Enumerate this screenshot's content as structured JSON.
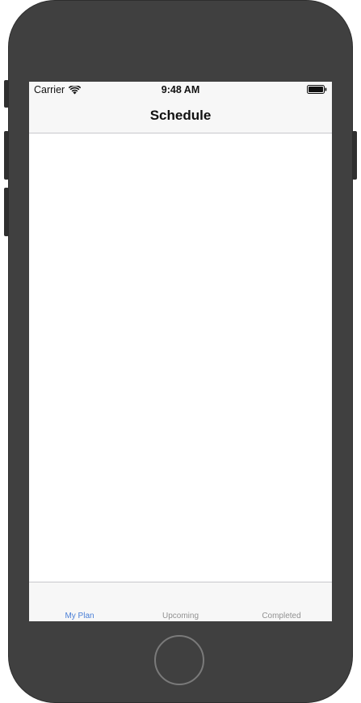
{
  "status_bar": {
    "carrier": "Carrier",
    "time": "9:48 AM",
    "wifi_icon": "wifi-icon",
    "battery_icon": "battery-icon"
  },
  "nav_bar": {
    "title": "Schedule"
  },
  "tab_bar": {
    "tabs": [
      {
        "label": "My Plan",
        "active": true
      },
      {
        "label": "Upcoming",
        "active": false
      },
      {
        "label": "Completed",
        "active": false
      }
    ]
  },
  "colors": {
    "accent": "#4a7fd6",
    "inactive_tab": "#929292",
    "bar_background": "#f7f7f7",
    "device_frame": "#404040"
  }
}
